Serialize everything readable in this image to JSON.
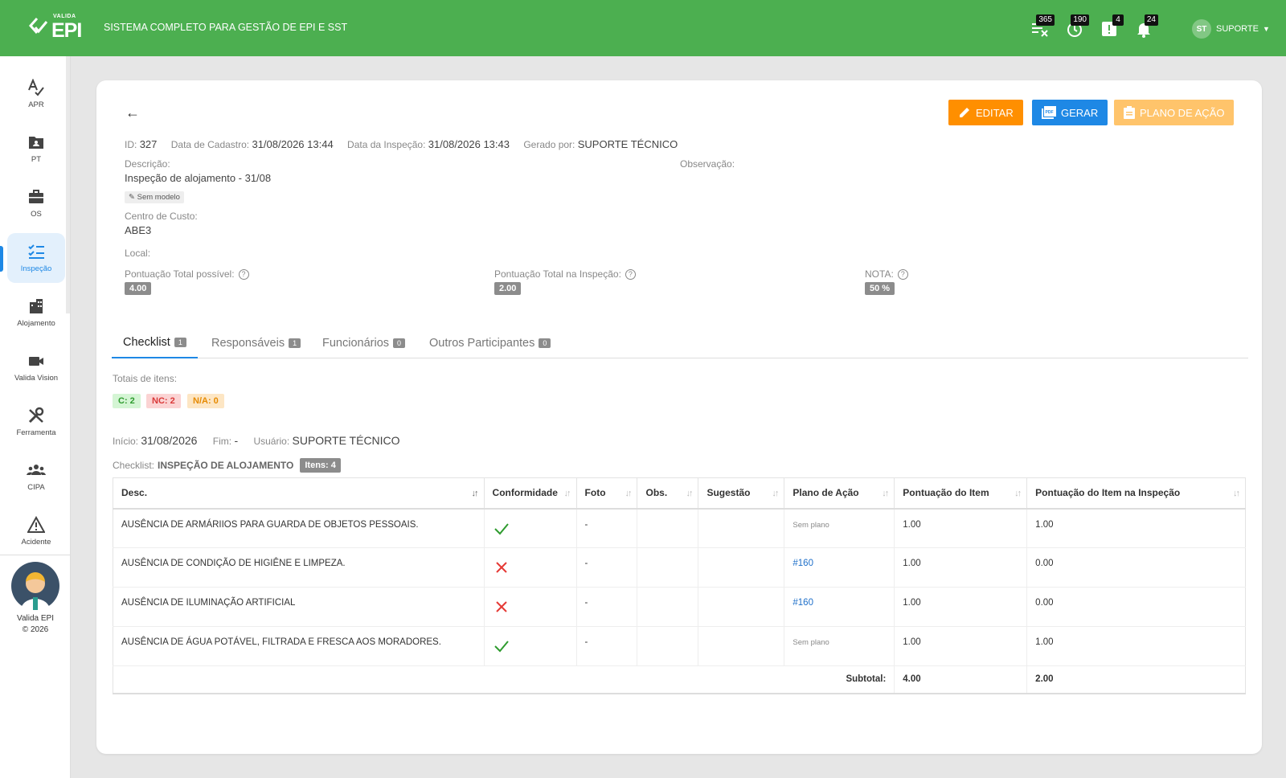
{
  "header": {
    "logo_small": "VALIDA",
    "logo_big": "EPI",
    "title": "SISTEMA COMPLETO PARA GESTÃO DE EPI E SST",
    "icons": [
      {
        "name": "pending-epi-icon",
        "badge": "365"
      },
      {
        "name": "history-icon",
        "badge": "190"
      },
      {
        "name": "alert-icon",
        "badge": "4"
      },
      {
        "name": "bell-icon",
        "badge": "24"
      }
    ],
    "user_initials": "ST",
    "user_name": "SUPORTE"
  },
  "sidebar": {
    "items": [
      {
        "label": "APR",
        "icon": "apr-icon"
      },
      {
        "label": "PT",
        "icon": "pt-icon"
      },
      {
        "label": "OS",
        "icon": "briefcase-icon"
      },
      {
        "label": "Inspeção",
        "icon": "checklist-icon",
        "active": true
      },
      {
        "label": "Alojamento",
        "icon": "building-icon"
      },
      {
        "label": "Valida Vision",
        "icon": "camera-icon"
      },
      {
        "label": "Ferramenta",
        "icon": "tools-icon"
      },
      {
        "label": "CIPA",
        "icon": "group-icon"
      },
      {
        "label": "Acidente",
        "icon": "warning-icon"
      }
    ],
    "footer_line1": "Valida EPI",
    "footer_line2": "© 2026"
  },
  "actions": {
    "edit": "EDITAR",
    "generate": "GERAR",
    "action_plan": "PLANO DE AÇÃO",
    "colors": {
      "edit": "#ff8f00",
      "generate": "#1e88e5",
      "action_plan": "#ffc46b"
    }
  },
  "meta": {
    "id_label": "ID:",
    "id": "327",
    "created_label": "Data de Cadastro:",
    "created": "31/08/2026 13:44",
    "inspection_date_label": "Data da Inspeção:",
    "inspection_date": "31/08/2026 13:43",
    "generated_by_label": "Gerado por:",
    "generated_by": "SUPORTE TÉCNICO"
  },
  "details": {
    "description_label": "Descrição:",
    "description": "Inspeção de alojamento - 31/08",
    "model_chip": "Sem modelo",
    "observation_label": "Observação:",
    "cost_center_label": "Centro de Custo:",
    "cost_center": "ABE3",
    "location_label": "Local:",
    "total_possible_label": "Pontuação Total possível:",
    "total_possible": "4.00",
    "total_inspection_label": "Pontuação Total na Inspeção:",
    "total_inspection": "2.00",
    "grade_label": "NOTA:",
    "grade": "50 %"
  },
  "tabs": [
    {
      "label": "Checklist",
      "count": "1"
    },
    {
      "label": "Responsáveis",
      "count": "1"
    },
    {
      "label": "Funcionários",
      "count": "0"
    },
    {
      "label": "Outros Participantes",
      "count": "0"
    }
  ],
  "totals": {
    "label": "Totais de itens:",
    "c": "C: 2",
    "nc": "NC: 2",
    "na": "N/A: 0"
  },
  "run": {
    "start_label": "Início:",
    "start": "31/08/2026",
    "end_label": "Fim:",
    "end": "-",
    "user_label": "Usuário:",
    "user": "SUPORTE TÉCNICO",
    "checklist_label": "Checklist:",
    "checklist": "INSPEÇÃO DE ALOJAMENTO",
    "items": "Itens: 4"
  },
  "table": {
    "columns": [
      "Desc.",
      "Conformidade",
      "Foto",
      "Obs.",
      "Sugestão",
      "Plano de Ação",
      "Pontuação do Item",
      "Pontuação do Item na Inspeção"
    ],
    "rows": [
      {
        "desc": "AUSÊNCIA DE ARMÁRIIOS PARA GUARDA DE OBJETOS PESSOAIS.",
        "conform": "check",
        "photo": "-",
        "obs": "",
        "suggestion": "",
        "plan": "Sem plano",
        "score": "1.00",
        "score_insp": "1.00"
      },
      {
        "desc": "AUSÊNCIA DE CONDIÇÃO DE HIGIÊNE E LIMPEZA.",
        "conform": "cross",
        "photo": "-",
        "obs": "",
        "suggestion": "",
        "plan": "#160",
        "score": "1.00",
        "score_insp": "0.00"
      },
      {
        "desc": "AUSÊNCIA DE ILUMINAÇÃO ARTIFICIAL",
        "conform": "cross",
        "photo": "-",
        "obs": "",
        "suggestion": "",
        "plan": "#160",
        "score": "1.00",
        "score_insp": "0.00"
      },
      {
        "desc": "AUSÊNCIA DE ÁGUA POTÁVEL, FILTRADA E FRESCA AOS MORADORES.",
        "conform": "check",
        "photo": "-",
        "obs": "",
        "suggestion": "",
        "plan": "Sem plano",
        "score": "1.00",
        "score_insp": "1.00"
      }
    ],
    "subtotal_label": "Subtotal:",
    "subtotal_score": "4.00",
    "subtotal_insp": "2.00"
  }
}
